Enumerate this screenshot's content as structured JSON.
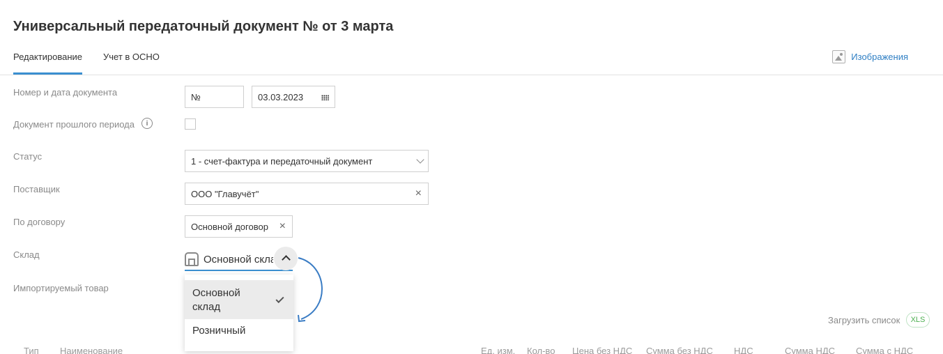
{
  "page_title": "Универсальный передаточный документ № от 3 марта",
  "tabs": [
    "Редактирование",
    "Учет в ОСНО"
  ],
  "images_link": "Изображения",
  "form": {
    "doc_number_label": "Номер и дата документа",
    "doc_number_value": "№",
    "doc_date_value": "03.03.2023",
    "past_period_label": "Документ прошлого периода",
    "info_icon_glyph": "i",
    "status_label": "Статус",
    "status_value": "1 - счет-фактура и передаточный документ",
    "supplier_label": "Поставщик",
    "supplier_value": "ООО \"Главучёт\"",
    "contract_label": "По договору",
    "contract_value": "Основной договор",
    "warehouse_label": "Склад",
    "warehouse_value": "Основной склад",
    "imported_label": "Импортируемый товар",
    "clear_glyph": "×"
  },
  "warehouse_dropdown": {
    "selected": "Основной склад",
    "options": [
      "Основной склад",
      "Розничный"
    ]
  },
  "table": {
    "load_list_label": "Загрузить список",
    "xls_badge": "XLS",
    "columns": [
      "Тип",
      "Наименование",
      "Ед. изм.",
      "Кол-во",
      "Цена без НДС",
      "Сумма без НДС",
      "НДС",
      "Сумма НДС",
      "Сумма с НДС"
    ]
  },
  "icons": {
    "images": "image-icon",
    "info": "info-icon",
    "calendar": "calendar-icon",
    "dropdown": "chevron-down-icon",
    "clear": "close-icon",
    "warehouse": "warehouse-icon",
    "collapse": "chevron-up-icon",
    "checkmark": "check-icon",
    "arrow": "curved-arrow-icon"
  },
  "colors": {
    "accent": "#3a8fd0",
    "link": "#2f7fc4",
    "xls_green": "#4caf50",
    "muted_label": "#8a8a8a"
  }
}
